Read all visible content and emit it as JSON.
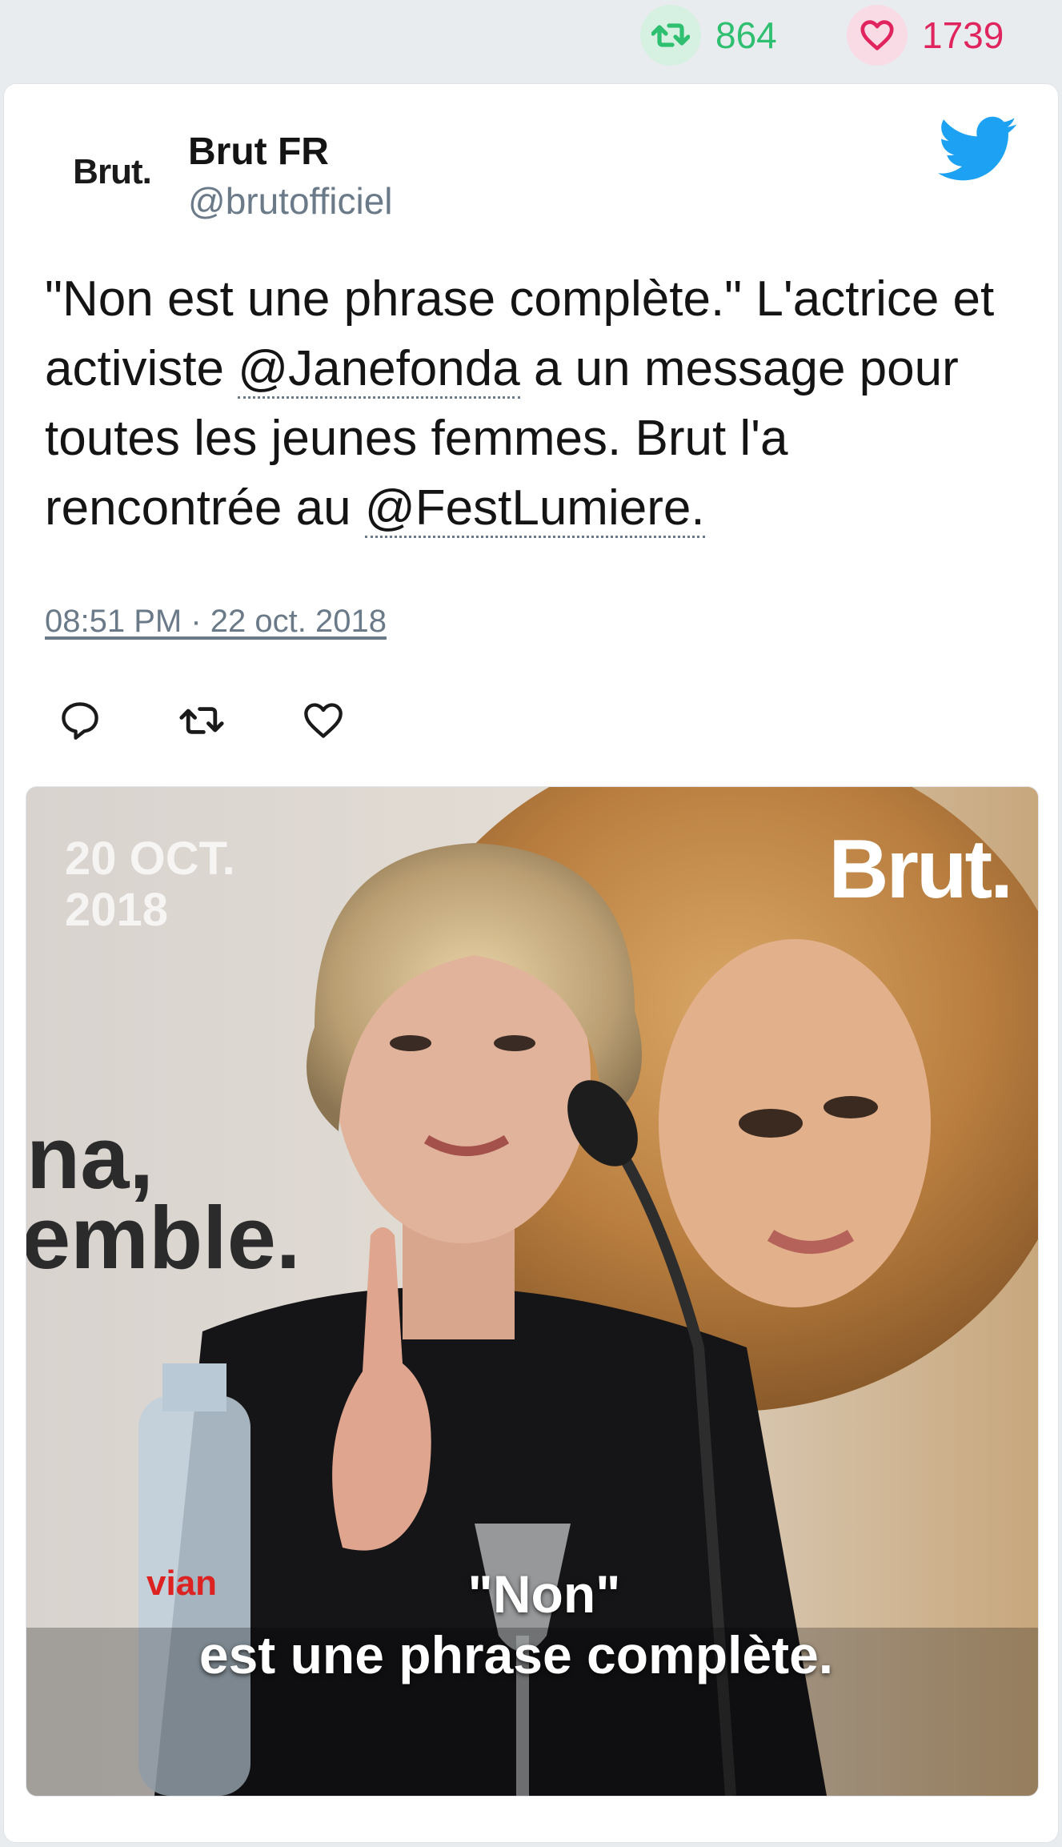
{
  "stats": {
    "retweets": "864",
    "likes": "1739"
  },
  "author": {
    "avatar_text": "Brut.",
    "name": "Brut FR",
    "handle": "@brutofficiel"
  },
  "tweet": {
    "text_1": "\"Non est une phrase complète.\" L'actrice et activiste ",
    "mention_1": "@Janefonda",
    "text_2": " a un message pour toutes les jeunes femmes. Brut l'a rencontrée au ",
    "mention_2": "@FestLumiere.",
    "timestamp": "08:51 PM · 22 oct. 2018"
  },
  "media": {
    "date_overlay": "20 OCT.\n2018",
    "logo_text": "Brut.",
    "background_text_1": "na,",
    "background_text_2": "emble.",
    "bottle_label": "vian",
    "caption_line_1": "\"Non\"",
    "caption_line_2": "est une phrase complète."
  },
  "icons": {
    "retweet": "retweet-icon",
    "like": "heart-icon",
    "reply": "reply-icon",
    "brand": "twitter-bird-icon"
  },
  "colors": {
    "retweet_green": "#2fbf71",
    "like_red": "#e0245e",
    "twitter_blue": "#1da1f2",
    "muted_text": "#6b7a88"
  }
}
